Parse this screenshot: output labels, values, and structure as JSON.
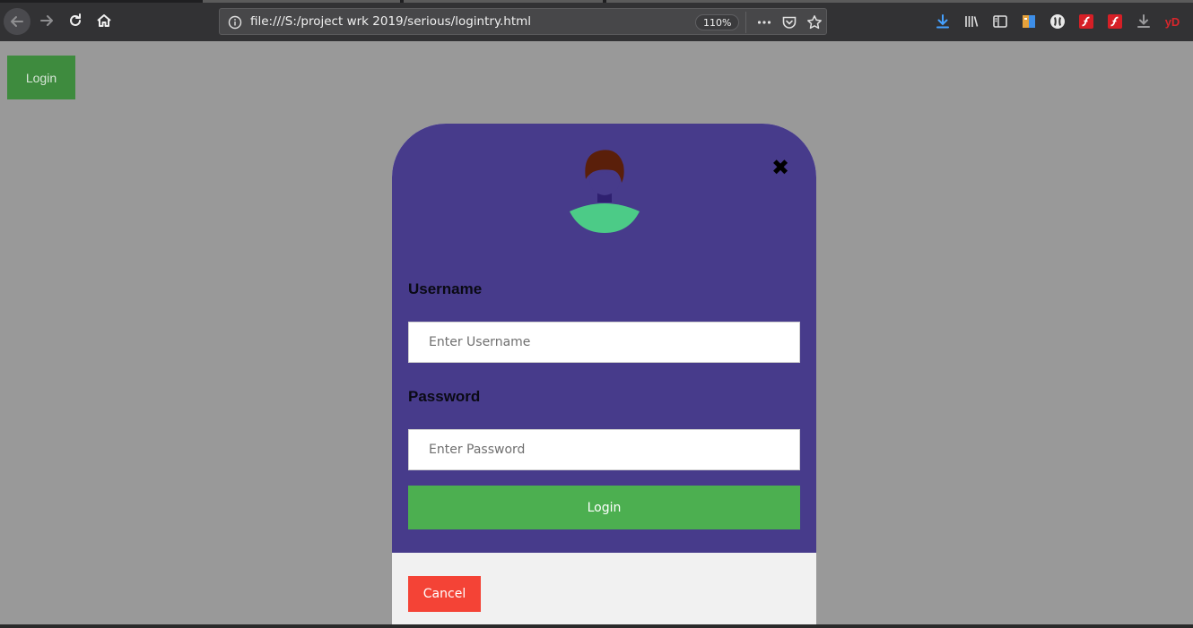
{
  "browser": {
    "url": "file:///S:/project wrk 2019/serious/logintry.html",
    "zoom": "110%",
    "icons": [
      "back-icon",
      "forward-icon",
      "reload-icon",
      "home-icon",
      "info-icon",
      "more-icon",
      "pocket-icon",
      "star-icon",
      "download-icon",
      "library-icon",
      "sidebar-icon",
      "extension-icon",
      "privacy-badger-icon",
      "flash-icon",
      "flash-icon",
      "download-helper-icon",
      "yd-icon"
    ],
    "yd_label": "yD"
  },
  "page": {
    "open_login_label": "Login"
  },
  "modal": {
    "username_label": "Username",
    "username_placeholder": "Enter Username",
    "password_label": "Password",
    "password_placeholder": "Enter Password",
    "submit_label": "Login",
    "cancel_label": "Cancel",
    "close_glyph": "✖"
  },
  "colors": {
    "overlay": "#999999",
    "modal_header": "#473b8b",
    "modal_footer": "#f1f1f1",
    "submit": "#4caf50",
    "cancel": "#f44336",
    "page_login": "#3e8b3e",
    "avatar_hair": "#5a1f0a",
    "avatar_body": "#4ccb87"
  }
}
